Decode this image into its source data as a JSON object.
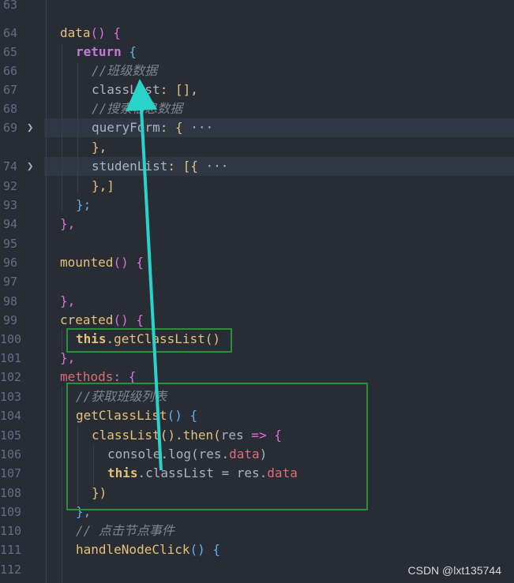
{
  "gutter": [
    "63",
    "64",
    "65",
    "66",
    "67",
    "68",
    "69",
    "74",
    "92",
    "93",
    "94",
    "95",
    "96",
    "97",
    "98",
    "99",
    "100",
    "101",
    "102",
    "103",
    "104",
    "105",
    "106",
    "107",
    "108",
    "109",
    "110",
    "111",
    "112"
  ],
  "code": {
    "l63": "",
    "l64_a": "data",
    "l64_b": "() {",
    "l65_a": "return",
    "l65_b": " {",
    "l66": "//班级数据",
    "l67_a": "classList",
    "l67_b": ": [],",
    "l68": "//搜索信息数据",
    "l69_a": "queryForm",
    "l69_b": ": {",
    "l69_c": " ···",
    "l74_close": "},",
    "l74_a": "studenList",
    "l74_b": ": [{",
    "l74_c": " ···",
    "l92": "},]",
    "l93": "};",
    "l94": "},",
    "l96_a": "mounted",
    "l96_b": "() {",
    "l98": "},",
    "l99_a": "created",
    "l99_b": "() {",
    "l100_a": "this",
    "l100_b": ".getClassList()",
    "l101": "},",
    "l102_a": "methods",
    "l102_b": ": {",
    "l103": "//获取班级列表",
    "l104_a": "getClassList",
    "l104_b": "() {",
    "l105_a": "classList",
    "l105_b": "().then(",
    "l105_c": "res",
    "l105_d": " => {",
    "l106_a": "console",
    "l106_b": ".log(res.",
    "l106_c": "data",
    "l106_d": ")",
    "l107_a": "this",
    "l107_b": ".classList = res.",
    "l107_c": "data",
    "l108": "})",
    "l109": "},",
    "l110": "// 点击节点事件",
    "l111_a": "handleNodeClick",
    "l111_b": "() {"
  },
  "watermark": "CSDN @lxt135744",
  "colors": {
    "background": "#282c34",
    "box": "#2e8b3a",
    "arrow": "#2ad3c9"
  }
}
